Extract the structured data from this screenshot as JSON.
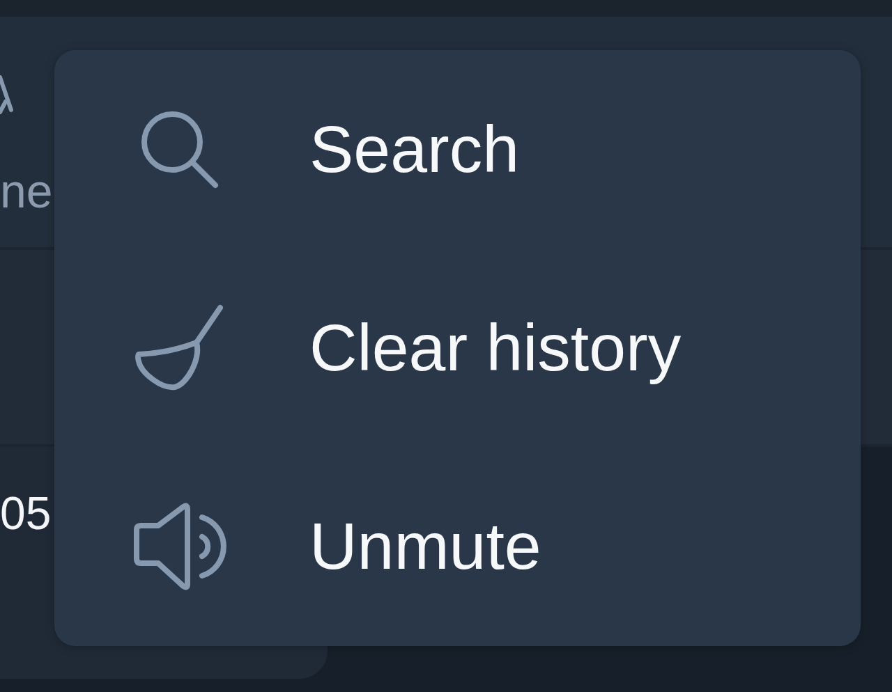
{
  "header": {
    "label": "ne"
  },
  "message": {
    "time": "05"
  },
  "context_menu": {
    "items": [
      {
        "kind": "search",
        "label": "Search"
      },
      {
        "kind": "clear",
        "label": "Clear history"
      },
      {
        "kind": "sound",
        "label": "Unmute"
      }
    ]
  }
}
